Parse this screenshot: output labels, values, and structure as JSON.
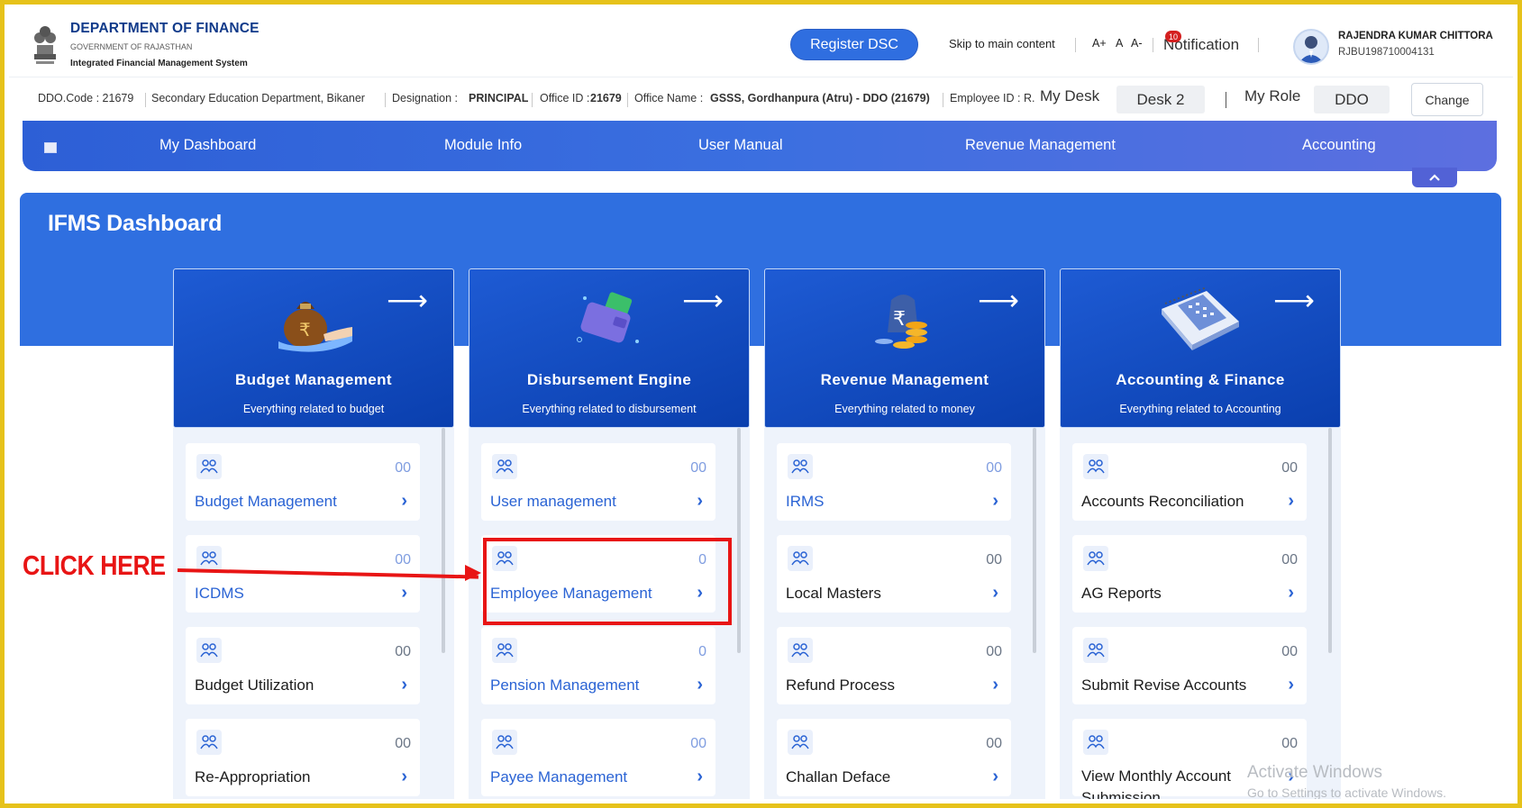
{
  "header": {
    "dept_title": "DEPARTMENT OF FINANCE",
    "dept_sub": "GOVERNMENT OF RAJASTHAN",
    "system_name": "Integrated Financial Management System",
    "register_btn": "Register DSC",
    "skip_link": "Skip to main content",
    "font_plus": "A+",
    "font_normal": "A",
    "font_minus": "A-",
    "notification_label": "Notification",
    "notification_count": "10",
    "user_name": "RAJENDRA KUMAR CHITTORA",
    "user_id": "RJBU198710004131"
  },
  "infobar": {
    "ddo_code": "DDO.Code : 21679",
    "department": "Secondary Education Department, Bikaner",
    "designation_label": "Designation : ",
    "designation": "PRINCIPAL",
    "office_id_label": "Office ID : ",
    "office_id": "21679",
    "office_name_label": "Office Name : ",
    "office_name": "GSSS, Gordhanpura (Atru) - DDO (21679)",
    "employee_id_label": "Employee ID : R.",
    "my_desk_label": "My Desk",
    "desk_value": "Desk 2",
    "my_role_label": "My Role",
    "role_value": "DDO",
    "change_btn": "Change"
  },
  "nav": {
    "items": [
      "My Dashboard",
      "Module Info",
      "User Manual",
      "Revenue Management",
      "Accounting"
    ]
  },
  "dashboard": {
    "title": "IFMS Dashboard",
    "modules": [
      {
        "title": "Budget Management",
        "desc": "Everything related to budget",
        "cards": [
          {
            "label": "Budget Management",
            "count": "00"
          },
          {
            "label": "ICDMS",
            "count": "00"
          },
          {
            "label": "Budget Utilization",
            "count": "00"
          },
          {
            "label": "Re-Appropriation",
            "count": "00"
          }
        ]
      },
      {
        "title": "Disbursement Engine",
        "desc": "Everything related to disbursement",
        "cards": [
          {
            "label": "User management",
            "count": "00"
          },
          {
            "label": "Employee Management",
            "count": "0"
          },
          {
            "label": "Pension Management",
            "count": "0"
          },
          {
            "label": "Payee Management",
            "count": "00"
          }
        ]
      },
      {
        "title": "Revenue Management",
        "desc": "Everything related to money",
        "cards": [
          {
            "label": "IRMS",
            "count": "00"
          },
          {
            "label": "Local Masters",
            "count": "00"
          },
          {
            "label": "Refund Process",
            "count": "00"
          },
          {
            "label": "Challan Deface",
            "count": "00"
          }
        ]
      },
      {
        "title": "Accounting & Finance",
        "desc": "Everything related to Accounting",
        "cards": [
          {
            "label": "Accounts Reconciliation",
            "count": "00"
          },
          {
            "label": "AG Reports",
            "count": "00"
          },
          {
            "label": "Submit Revise Accounts",
            "count": "00"
          },
          {
            "label": "View Monthly Account Submission",
            "count": "00"
          }
        ]
      }
    ]
  },
  "annotation": {
    "click_here": "CLICK HERE"
  },
  "watermark": {
    "line1": "Activate Windows",
    "line2": "Go to Settings to activate Windows."
  },
  "colors": {
    "brand_blue": "#2f6fe0",
    "highlight_red": "#e81515",
    "frame_yellow": "#e6c21a"
  }
}
